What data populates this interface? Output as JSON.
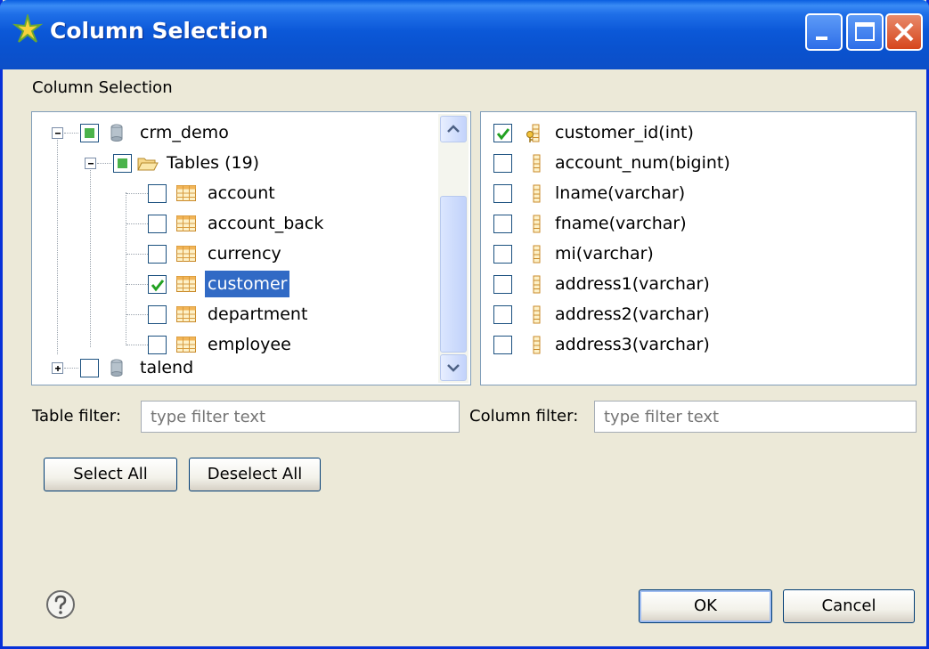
{
  "window": {
    "title": "Column Selection",
    "section_label": "Column Selection"
  },
  "tree": {
    "nodes": [
      {
        "label": "crm_demo",
        "state": "partial",
        "expanded": true
      },
      {
        "label": "Tables (19)",
        "state": "partial",
        "expanded": true
      },
      {
        "label": "account",
        "state": "unchecked"
      },
      {
        "label": "account_back",
        "state": "unchecked"
      },
      {
        "label": "currency",
        "state": "unchecked"
      },
      {
        "label": "customer",
        "state": "checked",
        "selected": true
      },
      {
        "label": "department",
        "state": "unchecked"
      },
      {
        "label": "employee",
        "state": "unchecked"
      },
      {
        "label": "talend",
        "state": "unchecked",
        "expanded": false
      }
    ]
  },
  "columns": {
    "items": [
      {
        "label": "customer_id(int)",
        "checked": true,
        "key": true
      },
      {
        "label": "account_num(bigint)",
        "checked": false
      },
      {
        "label": "lname(varchar)",
        "checked": false
      },
      {
        "label": "fname(varchar)",
        "checked": false
      },
      {
        "label": "mi(varchar)",
        "checked": false
      },
      {
        "label": "address1(varchar)",
        "checked": false
      },
      {
        "label": "address2(varchar)",
        "checked": false
      },
      {
        "label": "address3(varchar)",
        "checked": false
      }
    ]
  },
  "filters": {
    "table_label": "Table filter:",
    "table_placeholder": "type filter text",
    "column_label": "Column filter:",
    "column_placeholder": "type filter text"
  },
  "buttons": {
    "select_all": "Select All",
    "deselect_all": "Deselect All",
    "ok": "OK",
    "cancel": "Cancel"
  },
  "colors": {
    "title_bar": "#0a55d6",
    "selection": "#316ac5",
    "dialog_bg": "#ece9d8"
  }
}
